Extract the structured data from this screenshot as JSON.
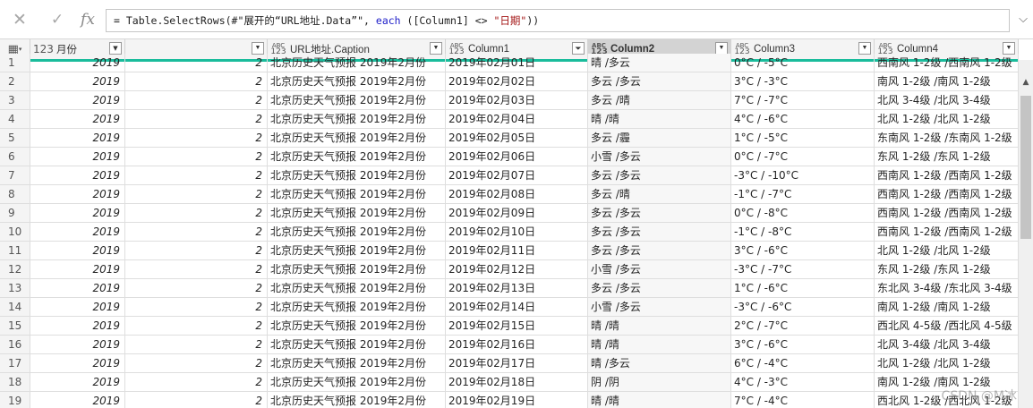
{
  "formula": {
    "cancel_icon": "close-icon",
    "commit_icon": "check-icon",
    "fx_label": "fx",
    "prefix": "= Table.SelectRows(#\"展开的“URL地址.Data”\", ",
    "keyword": "each",
    "middle": " ([Column1] <> ",
    "string": "\"日期\"",
    "suffix": "))"
  },
  "columns": [
    {
      "name": "月份",
      "type": "123",
      "type_kind": "num"
    },
    {
      "name": "URL地址.Caption",
      "type": "ABC 123",
      "type_kind": "any"
    },
    {
      "name": "Column1",
      "type": "ABC 123",
      "type_kind": "any",
      "filtered": true
    },
    {
      "name": "Column2",
      "type": "ABC 123",
      "type_kind": "any",
      "active": true
    },
    {
      "name": "Column3",
      "type": "ABC 123",
      "type_kind": "any"
    },
    {
      "name": "Column4",
      "type": "ABC 123",
      "type_kind": "any"
    }
  ],
  "rows": [
    {
      "n": "1",
      "year": "2019",
      "month": "2",
      "caption": "北京历史天气预报 2019年2月份",
      "c1": "2019年02月01日",
      "c2": "晴 /多云",
      "c3": "0°C / -5°C",
      "c4": "西南风 1-2级 /西南风 1-2级"
    },
    {
      "n": "2",
      "year": "2019",
      "month": "2",
      "caption": "北京历史天气预报 2019年2月份",
      "c1": "2019年02月02日",
      "c2": "多云 /多云",
      "c3": "3°C / -3°C",
      "c4": "南风 1-2级 /南风 1-2级"
    },
    {
      "n": "3",
      "year": "2019",
      "month": "2",
      "caption": "北京历史天气预报 2019年2月份",
      "c1": "2019年02月03日",
      "c2": "多云 /晴",
      "c3": "7°C / -7°C",
      "c4": "北风 3-4级 /北风 3-4级"
    },
    {
      "n": "4",
      "year": "2019",
      "month": "2",
      "caption": "北京历史天气预报 2019年2月份",
      "c1": "2019年02月04日",
      "c2": "晴 /晴",
      "c3": "4°C / -6°C",
      "c4": "北风 1-2级 /北风 1-2级"
    },
    {
      "n": "5",
      "year": "2019",
      "month": "2",
      "caption": "北京历史天气预报 2019年2月份",
      "c1": "2019年02月05日",
      "c2": "多云 /霾",
      "c3": "1°C / -5°C",
      "c4": "东南风 1-2级 /东南风 1-2级"
    },
    {
      "n": "6",
      "year": "2019",
      "month": "2",
      "caption": "北京历史天气预报 2019年2月份",
      "c1": "2019年02月06日",
      "c2": "小雪 /多云",
      "c3": "0°C / -7°C",
      "c4": "东风 1-2级 /东风 1-2级"
    },
    {
      "n": "7",
      "year": "2019",
      "month": "2",
      "caption": "北京历史天气预报 2019年2月份",
      "c1": "2019年02月07日",
      "c2": "多云 /多云",
      "c3": "-3°C / -10°C",
      "c4": "西南风 1-2级 /西南风 1-2级"
    },
    {
      "n": "8",
      "year": "2019",
      "month": "2",
      "caption": "北京历史天气预报 2019年2月份",
      "c1": "2019年02月08日",
      "c2": "多云 /晴",
      "c3": "-1°C / -7°C",
      "c4": "西南风 1-2级 /西南风 1-2级"
    },
    {
      "n": "9",
      "year": "2019",
      "month": "2",
      "caption": "北京历史天气预报 2019年2月份",
      "c1": "2019年02月09日",
      "c2": "多云 /多云",
      "c3": "0°C / -8°C",
      "c4": "西南风 1-2级 /西南风 1-2级"
    },
    {
      "n": "10",
      "year": "2019",
      "month": "2",
      "caption": "北京历史天气预报 2019年2月份",
      "c1": "2019年02月10日",
      "c2": "多云 /多云",
      "c3": "-1°C / -8°C",
      "c4": "西南风 1-2级 /西南风 1-2级"
    },
    {
      "n": "11",
      "year": "2019",
      "month": "2",
      "caption": "北京历史天气预报 2019年2月份",
      "c1": "2019年02月11日",
      "c2": "多云 /多云",
      "c3": "3°C / -6°C",
      "c4": "北风 1-2级 /北风 1-2级"
    },
    {
      "n": "12",
      "year": "2019",
      "month": "2",
      "caption": "北京历史天气预报 2019年2月份",
      "c1": "2019年02月12日",
      "c2": "小雪 /多云",
      "c3": "-3°C / -7°C",
      "c4": "东风 1-2级 /东风 1-2级"
    },
    {
      "n": "13",
      "year": "2019",
      "month": "2",
      "caption": "北京历史天气预报 2019年2月份",
      "c1": "2019年02月13日",
      "c2": "多云 /多云",
      "c3": "1°C / -6°C",
      "c4": "东北风 3-4级 /东北风 3-4级"
    },
    {
      "n": "14",
      "year": "2019",
      "month": "2",
      "caption": "北京历史天气预报 2019年2月份",
      "c1": "2019年02月14日",
      "c2": "小雪 /多云",
      "c3": "-3°C / -6°C",
      "c4": "南风 1-2级 /南风 1-2级"
    },
    {
      "n": "15",
      "year": "2019",
      "month": "2",
      "caption": "北京历史天气预报 2019年2月份",
      "c1": "2019年02月15日",
      "c2": "晴 /晴",
      "c3": "2°C / -7°C",
      "c4": "西北风 4-5级 /西北风 4-5级"
    },
    {
      "n": "16",
      "year": "2019",
      "month": "2",
      "caption": "北京历史天气预报 2019年2月份",
      "c1": "2019年02月16日",
      "c2": "晴 /晴",
      "c3": "3°C / -6°C",
      "c4": "北风 3-4级 /北风 3-4级"
    },
    {
      "n": "17",
      "year": "2019",
      "month": "2",
      "caption": "北京历史天气预报 2019年2月份",
      "c1": "2019年02月17日",
      "c2": "晴 /多云",
      "c3": "6°C / -4°C",
      "c4": "北风 1-2级 /北风 1-2级"
    },
    {
      "n": "18",
      "year": "2019",
      "month": "2",
      "caption": "北京历史天气预报 2019年2月份",
      "c1": "2019年02月18日",
      "c2": "阴 /阴",
      "c3": "4°C / -3°C",
      "c4": "南风 1-2级 /南风 1-2级"
    },
    {
      "n": "19",
      "year": "2019",
      "month": "2",
      "caption": "北京历史天气预报 2019年2月份",
      "c1": "2019年02月19日",
      "c2": "晴 /晴",
      "c3": "7°C / -4°C",
      "c4": "西北风 1-2级 /西北风 1-2级"
    }
  ],
  "colors": {
    "quality_bar": "#1abc9c",
    "active_header": "#d3d3d3"
  },
  "watermark": "CSDN @M冰"
}
